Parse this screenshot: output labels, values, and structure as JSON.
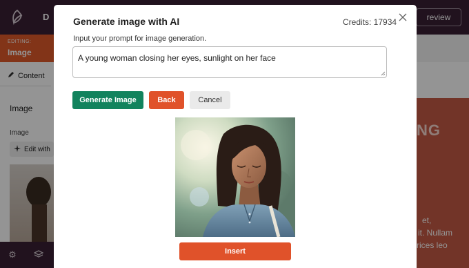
{
  "modal": {
    "title": "Generate image with AI",
    "credits": "Credits: 17934",
    "prompt_label": "Input your prompt for image generation.",
    "prompt_value": "A young woman closing her eyes, sunlight on her face",
    "buttons": {
      "generate": "Generate Image",
      "back": "Back",
      "cancel": "Cancel",
      "insert": "Insert"
    },
    "generated_image": "portrait-woman-eyes-closed-sunlight",
    "icons": {
      "close": "close-icon"
    }
  },
  "background": {
    "topbar_tab": "D",
    "preview_label": "review",
    "editing_small": "EDITING:",
    "editing_title": "Image",
    "content_tab": "Content",
    "panel_title": "Image",
    "panel_label": "Image",
    "edit_with_label": "Edit with",
    "canvas_heading": "NG",
    "canvas_text": [
      "et,",
      "it. Nullam",
      "rices leo"
    ]
  },
  "colors": {
    "topbar": "#3a1f35",
    "accent_orange": "#e0522a",
    "generate_green": "#12835d",
    "cancel_gray": "#eaeaea",
    "salmon_card": "#c55a45"
  }
}
